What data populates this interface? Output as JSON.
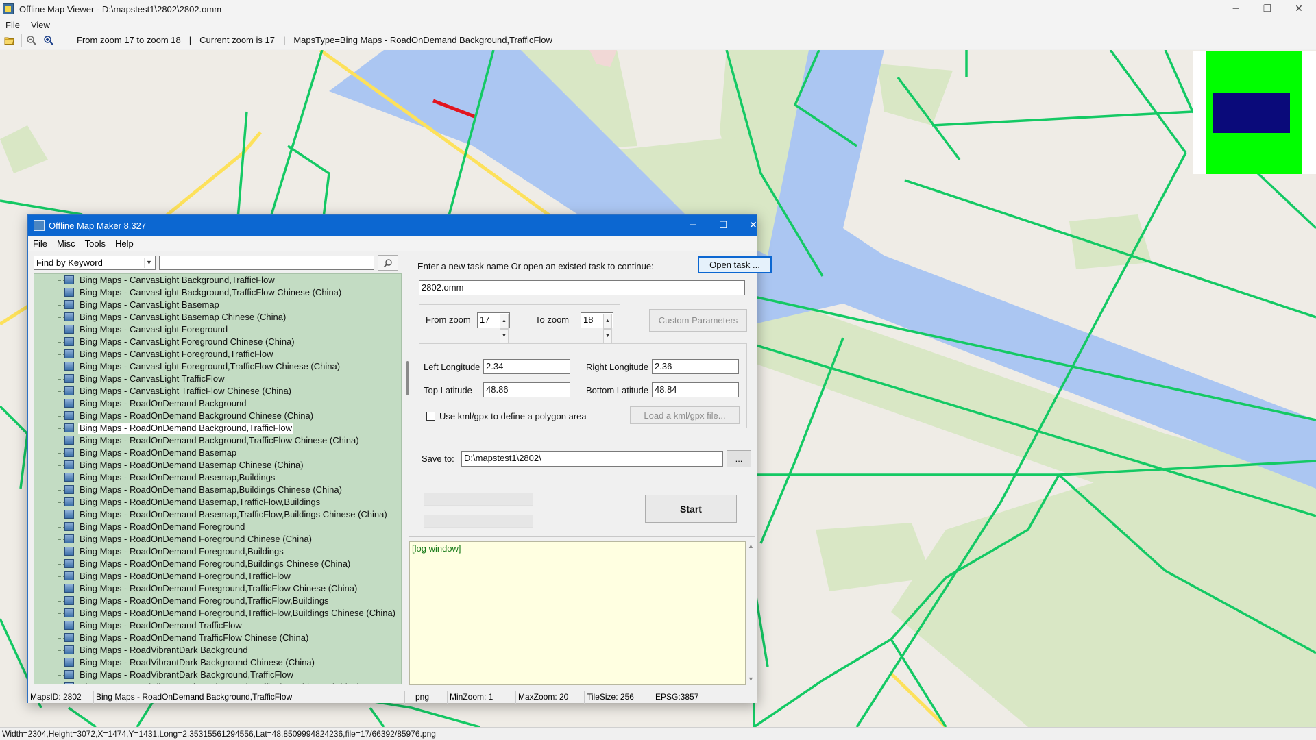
{
  "window": {
    "title": "Offline Map Viewer - D:\\mapstest1\\2802\\2802.omm",
    "controls": {
      "minimize": "─",
      "restore": "❐",
      "close": "✕"
    }
  },
  "menu": {
    "file": "File",
    "view": "View"
  },
  "toolbar": {
    "icons": [
      "open-folder-icon",
      "zoom-out-icon",
      "zoom-in-icon"
    ],
    "zoom_range": "From zoom 17 to zoom 18",
    "separator": "|",
    "current_zoom": "Current zoom is 17",
    "maps_type": "MapsType=Bing Maps - RoadOnDemand Background,TrafficFlow"
  },
  "map": {
    "colors": {
      "land": "#efece6",
      "park": "#d9e7c5",
      "water": "#abc6f2",
      "road_green": "#14c964",
      "road_yellow": "#fde15b",
      "traffic_red": "#e2151f"
    }
  },
  "status_bar": {
    "text": "Width=2304,Height=3072,X=1474,Y=1431,Long=2.35315561294556,Lat=48.8509994824236,file=17/66392/85976.png"
  },
  "dialog": {
    "title": "Offline Map Maker 8.327",
    "controls": {
      "minimize": "─",
      "maximize": "☐",
      "close": "✕"
    },
    "menu": [
      "File",
      "Misc",
      "Tools",
      "Help"
    ],
    "find": {
      "mode": "Find by Keyword",
      "keyword": "",
      "search_icon": "magnifier-icon"
    },
    "map_list": {
      "selected_index": 12,
      "items": [
        "Bing Maps - CanvasLight Background,TrafficFlow",
        "Bing Maps - CanvasLight Background,TrafficFlow Chinese (China)",
        "Bing Maps - CanvasLight Basemap",
        "Bing Maps - CanvasLight Basemap Chinese (China)",
        "Bing Maps - CanvasLight Foreground",
        "Bing Maps - CanvasLight Foreground Chinese (China)",
        "Bing Maps - CanvasLight Foreground,TrafficFlow",
        "Bing Maps - CanvasLight Foreground,TrafficFlow Chinese (China)",
        "Bing Maps - CanvasLight TrafficFlow",
        "Bing Maps - CanvasLight TrafficFlow Chinese (China)",
        "Bing Maps - RoadOnDemand Background",
        "Bing Maps - RoadOnDemand Background Chinese (China)",
        "Bing Maps - RoadOnDemand Background,TrafficFlow",
        "Bing Maps - RoadOnDemand Background,TrafficFlow Chinese (China)",
        "Bing Maps - RoadOnDemand Basemap",
        "Bing Maps - RoadOnDemand Basemap Chinese (China)",
        "Bing Maps - RoadOnDemand Basemap,Buildings",
        "Bing Maps - RoadOnDemand Basemap,Buildings Chinese (China)",
        "Bing Maps - RoadOnDemand Basemap,TrafficFlow,Buildings",
        "Bing Maps - RoadOnDemand Basemap,TrafficFlow,Buildings Chinese (China)",
        "Bing Maps - RoadOnDemand Foreground",
        "Bing Maps - RoadOnDemand Foreground Chinese (China)",
        "Bing Maps - RoadOnDemand Foreground,Buildings",
        "Bing Maps - RoadOnDemand Foreground,Buildings Chinese (China)",
        "Bing Maps - RoadOnDemand Foreground,TrafficFlow",
        "Bing Maps - RoadOnDemand Foreground,TrafficFlow Chinese (China)",
        "Bing Maps - RoadOnDemand Foreground,TrafficFlow,Buildings",
        "Bing Maps - RoadOnDemand Foreground,TrafficFlow,Buildings Chinese (China)",
        "Bing Maps - RoadOnDemand TrafficFlow",
        "Bing Maps - RoadOnDemand TrafficFlow Chinese (China)",
        "Bing Maps - RoadVibrantDark Background",
        "Bing Maps - RoadVibrantDark Background Chinese (China)",
        "Bing Maps - RoadVibrantDark Background,TrafficFlow",
        "Bing Maps - RoadVibrantDark Background,TrafficFlow Chinese (China)"
      ]
    },
    "task": {
      "prompt": "Enter a new task name Or open an existed task to continue:",
      "open_button": "Open task ...",
      "task_name": "2802.omm"
    },
    "zoom": {
      "from_label": "From zoom",
      "from_value": "17",
      "to_label": "To zoom",
      "to_value": "18",
      "custom_button": "Custom Parameters"
    },
    "bounds": {
      "left_label": "Left Longitude",
      "left_value": "2.34",
      "right_label": "Right Longitude",
      "right_value": "2.36",
      "top_label": "Top Latitude",
      "top_value": "48.86",
      "bottom_label": "Bottom Latitude",
      "bottom_value": "48.84",
      "kml_checkbox_label": "Use kml/gpx to define a polygon area",
      "kml_checked": false,
      "load_kml_button": "Load a kml/gpx file..."
    },
    "save": {
      "label": "Save to:",
      "path": "D:\\mapstest1\\2802\\",
      "browse_button": "..."
    },
    "start_button": "Start",
    "log": {
      "text": "[log window]"
    },
    "status": {
      "maps_id": "MapsID: 2802",
      "maps_name": "Bing Maps - RoadOnDemand Background,TrafficFlow",
      "format": "png",
      "min_zoom": "MinZoom: 1",
      "max_zoom": "MaxZoom: 20",
      "tile_size": "TileSize: 256",
      "epsg": "EPSG:3857"
    }
  }
}
